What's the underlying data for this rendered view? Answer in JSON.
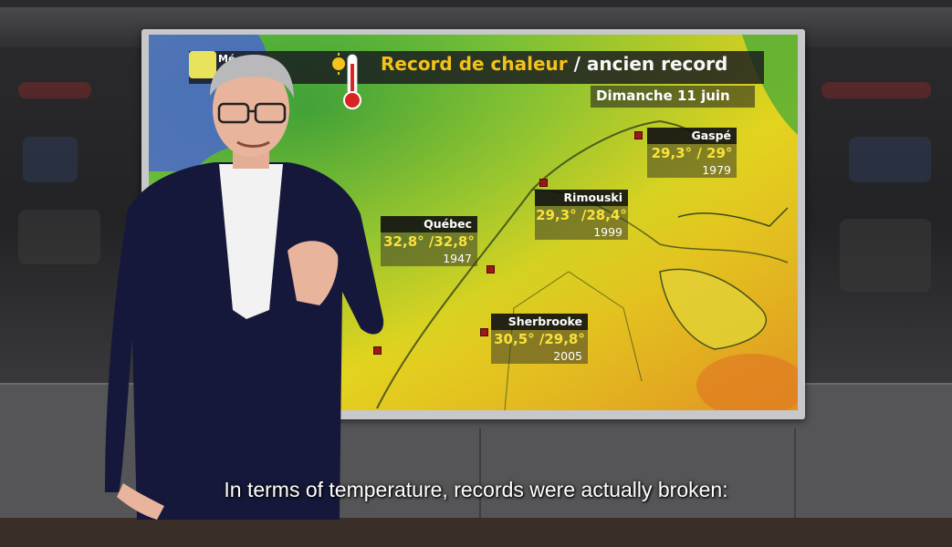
{
  "broadcast": {
    "logo_text": "Mé",
    "title_main": "Record de chaleur",
    "title_separator": "/",
    "title_secondary": "ancien record",
    "date": "Dimanche 11 juin"
  },
  "cities": [
    {
      "name": "Gaspé",
      "values": "29,3° / 29°",
      "year": "1979"
    },
    {
      "name": "Rimouski",
      "values": "29,3° /28,4°",
      "year": "1999"
    },
    {
      "name": "Québec",
      "values": "32,8° /32,8°",
      "year": "1947"
    },
    {
      "name": "Sherbrooke",
      "values": "30,5° /29,8°",
      "year": "2005"
    }
  ],
  "subtitle": "In terms of temperature, records were actually broken:",
  "colors": {
    "title_accent": "#f4c21b",
    "value_yellow": "#fbe13a",
    "marker_red": "#a0141b",
    "map_green": "#3aa63a",
    "map_yellow": "#e9d81e",
    "map_blue": "#4a5ee0"
  },
  "icons": {
    "thermometer": "thermometer-icon",
    "sun": "sun-icon",
    "logo": "weather-logo-icon"
  }
}
